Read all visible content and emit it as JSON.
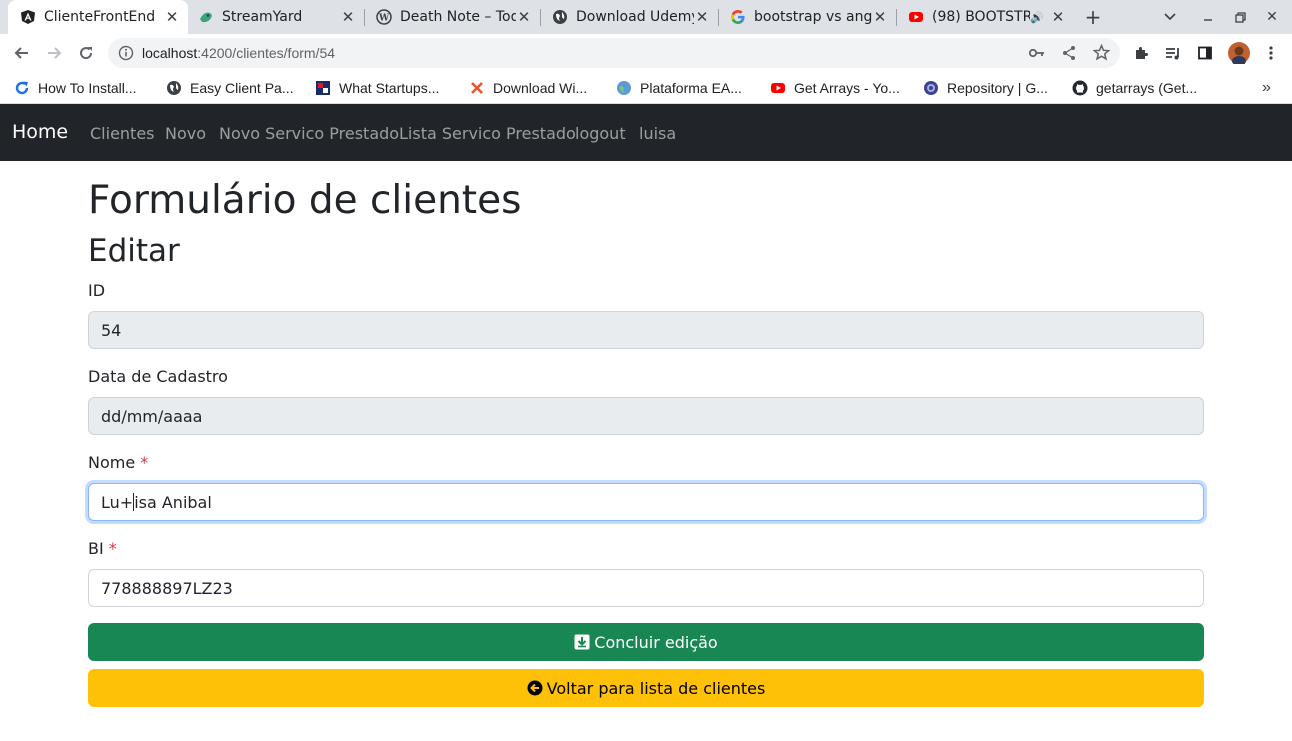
{
  "browser": {
    "tabs": [
      {
        "label": "ClienteFrontEnd",
        "icon": "angular-icon"
      },
      {
        "label": "StreamYard",
        "icon": "streamyard-icon"
      },
      {
        "label": "Death Note – Todos",
        "icon": "wordpress-icon"
      },
      {
        "label": "Download Udemy",
        "icon": "globe-icon"
      },
      {
        "label": "bootstrap vs angular",
        "icon": "google-icon"
      },
      {
        "label": "(98) BOOTSTRAP",
        "icon": "youtube-icon"
      }
    ],
    "url_host": "localhost",
    "url_path": ":4200/clientes/form/54",
    "bookmarks": [
      {
        "label": "How To Install...",
        "icon": "refresh-blue-icon"
      },
      {
        "label": "Easy Client Pa...",
        "icon": "globe-icon"
      },
      {
        "label": "What Startups...",
        "icon": "flag-icon"
      },
      {
        "label": "Download Wi...",
        "icon": "x-icon"
      },
      {
        "label": "Plataforma EA...",
        "icon": "globe-blue-icon"
      },
      {
        "label": "Get Arrays - Yo...",
        "icon": "youtube-icon"
      },
      {
        "label": "Repository | G...",
        "icon": "repository-icon"
      },
      {
        "label": "getarrays (Get...",
        "icon": "github-icon"
      }
    ]
  },
  "navbar": {
    "brand": "Home",
    "links": [
      "Clientes",
      "Novo",
      "Novo Servico Prestado",
      "Lista Servico Prestado",
      "logout",
      "luisa"
    ]
  },
  "page": {
    "title": "Formulário de clientes",
    "subtitle": "Editar"
  },
  "form": {
    "id_label": "ID",
    "id_value": "54",
    "date_label": "Data de Cadastro",
    "date_placeholder": "dd/mm/aaaa",
    "name_label": "Nome",
    "name_value_before_caret": "Lu+",
    "name_value_after_caret": "isa Anibal",
    "bi_label": "BI",
    "bi_value": "778888897LZ23",
    "required_marker": "*"
  },
  "actions": {
    "save_label": "Concluir edição",
    "back_label": "Voltar para lista de clientes"
  },
  "colors": {
    "navbar_bg": "#212529",
    "success": "#198754",
    "warning": "#ffc107",
    "required": "#dc3545"
  }
}
